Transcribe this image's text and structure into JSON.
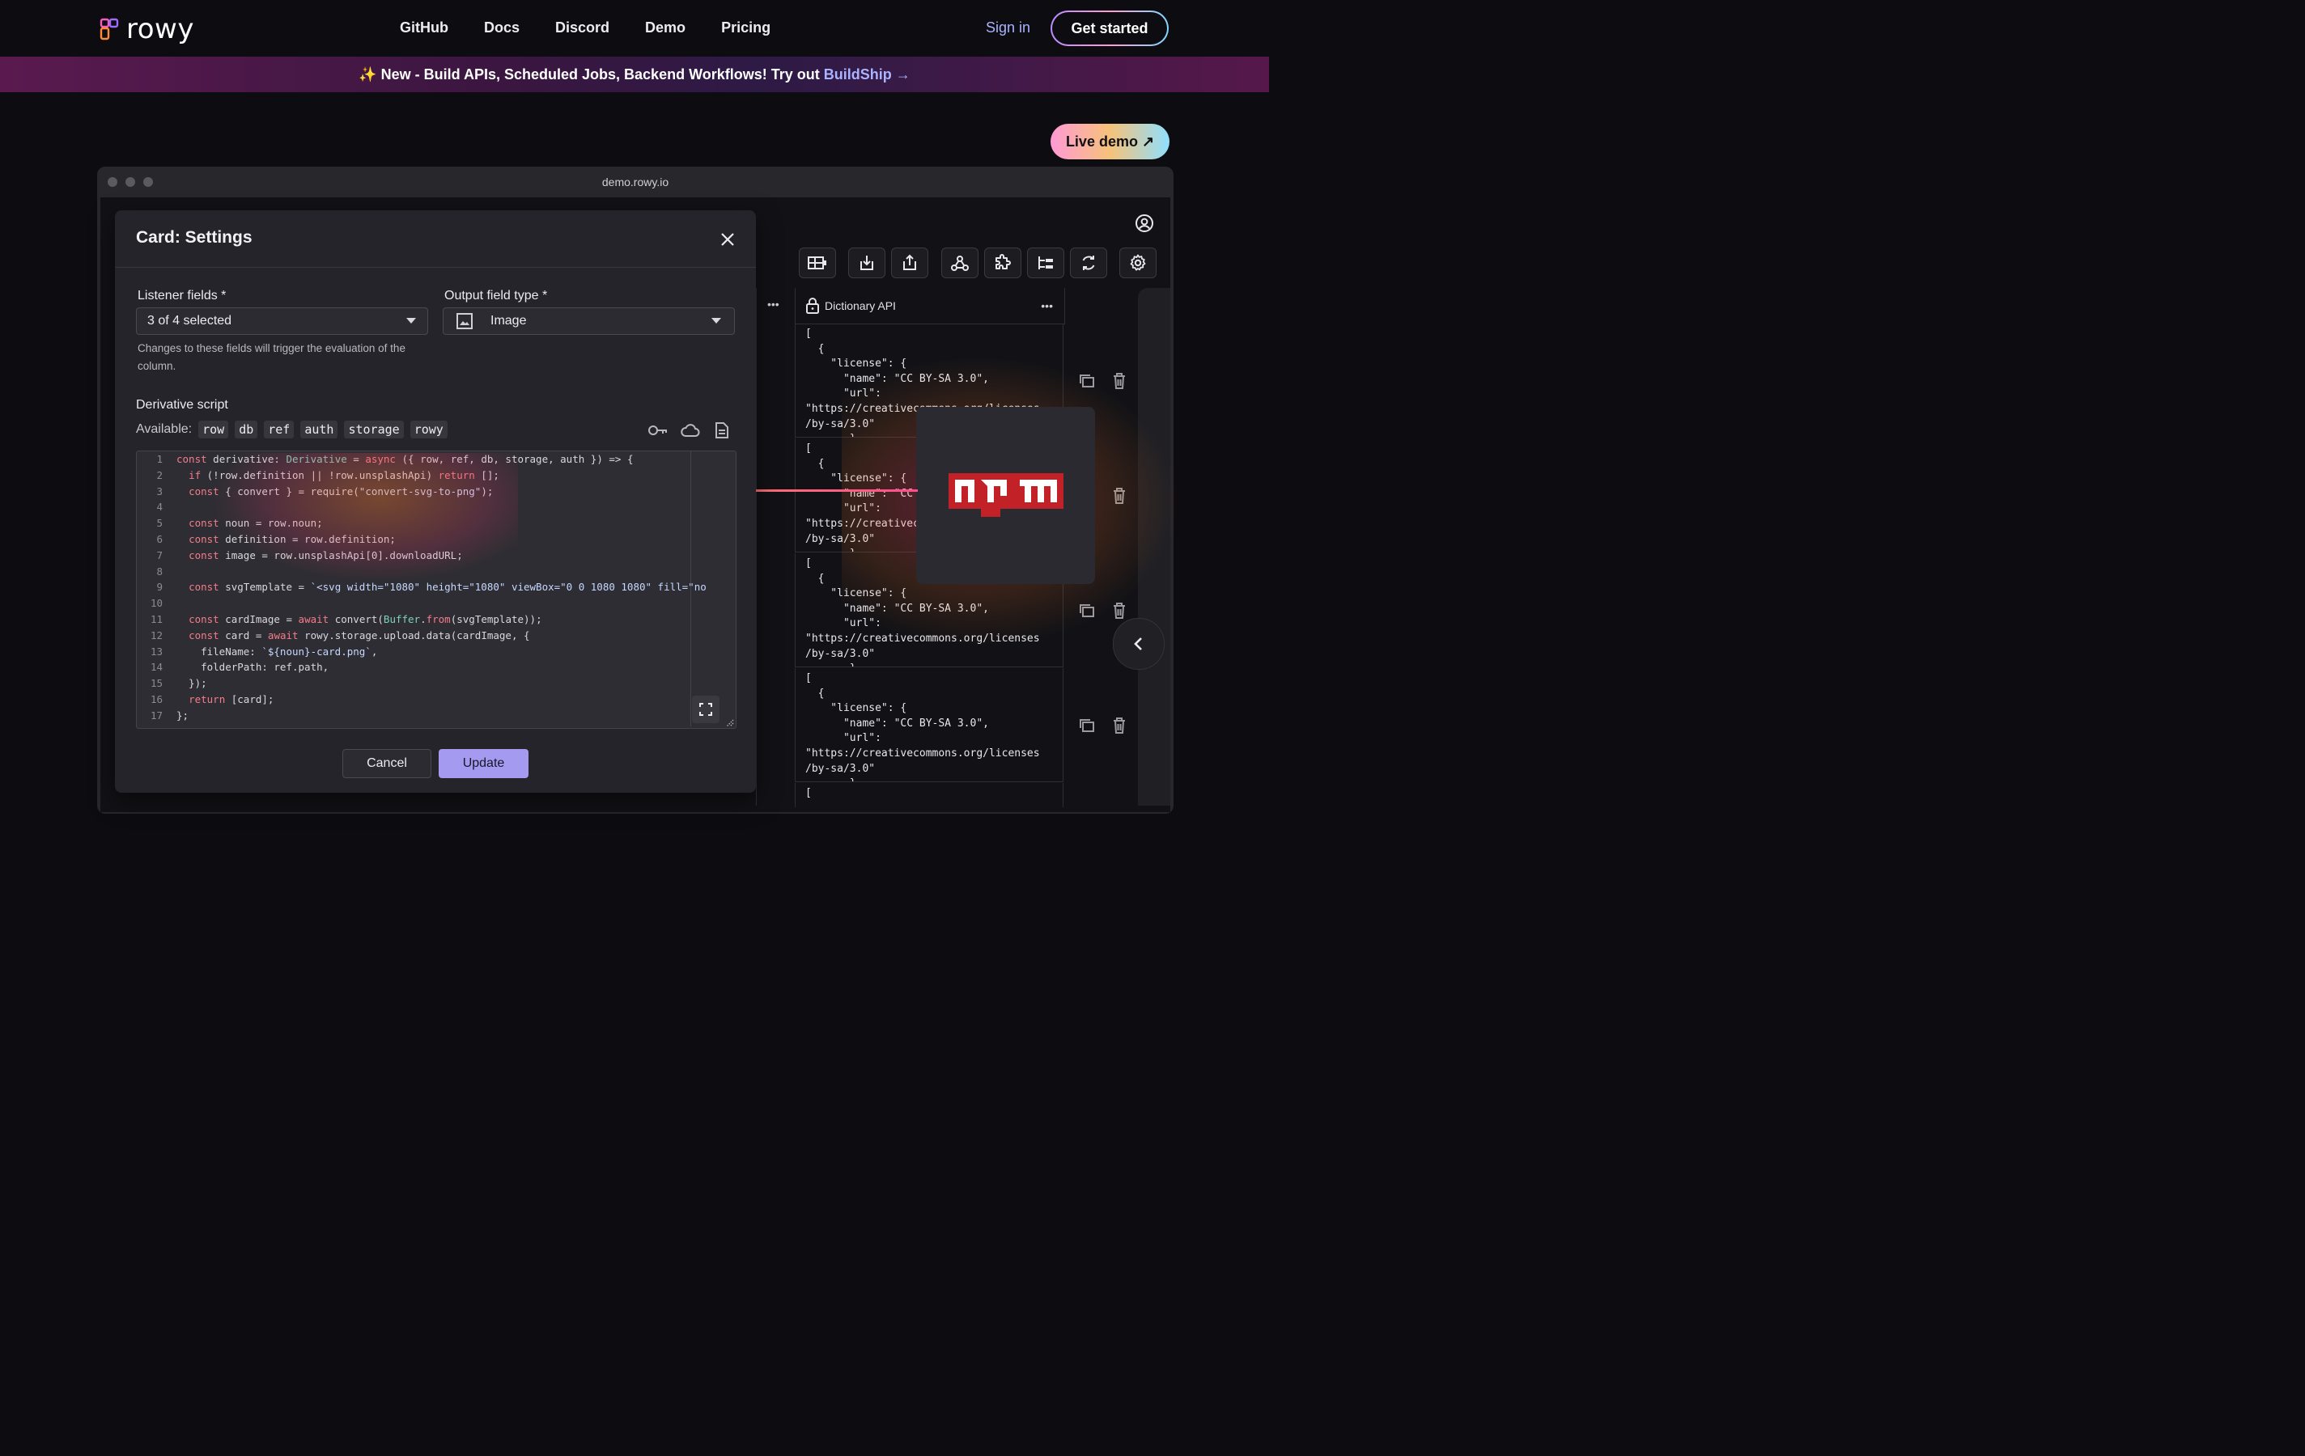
{
  "nav": {
    "logo_text": "rowy",
    "links": [
      "GitHub",
      "Docs",
      "Discord",
      "Demo",
      "Pricing"
    ],
    "sign_in": "Sign in",
    "get_started": "Get started"
  },
  "banner": {
    "text": "✨ New - Build APIs, Scheduled Jobs, Backend Workflows! Try out",
    "link": "BuildShip →"
  },
  "live_demo": "Live demo ↗",
  "browser": {
    "url": "demo.rowy.io"
  },
  "table": {
    "column_title": "Dictionary API",
    "column_menu": "•••",
    "left_menu": "•••",
    "cells": [
      "[\n  {\n    \"license\": {\n      \"name\": \"CC BY-SA 3.0\",\n      \"url\":\n\"https://creativecommons.org/licenses\n/by-sa/3.0\"\n       }",
      "[\n  {\n    \"license\": {\n      \"name\": \"CC BY-SA 3.0\",\n      \"url\":\n\"https://creativecommons.org/licenses\n/by-sa/3.0\"\n       }",
      "[\n  {\n    \"license\": {\n      \"name\": \"CC BY-SA 3.0\",\n      \"url\":\n\"https://creativecommons.org/licenses\n/by-sa/3.0\"\n       }",
      "[\n  {\n    \"license\": {\n      \"name\": \"CC BY-SA 3.0\",\n      \"url\":\n\"https://creativecommons.org/licenses\n/by-sa/3.0\"\n       }",
      "["
    ]
  },
  "dialog": {
    "title": "Card: Settings",
    "listener_label": "Listener fields *",
    "listener_value": "3 of 4 selected",
    "output_label": "Output field type *",
    "output_value": "Image",
    "helper": "Changes to these fields will trigger the evaluation of the column.",
    "script_label": "Derivative script",
    "available_label": "Available:",
    "chips": [
      "row",
      "db",
      "ref",
      "auth",
      "storage",
      "rowy"
    ],
    "cancel": "Cancel",
    "update": "Update"
  },
  "code_lines": [
    {
      "n": "1",
      "t": "const derivative: Derivative = async ({ row, ref, db, storage, auth }) => {"
    },
    {
      "n": "2",
      "t": "  if (!row.definition || !row.unsplashApi) return [];"
    },
    {
      "n": "3",
      "t": "  const { convert } = require(\"convert-svg-to-png\");"
    },
    {
      "n": "4",
      "t": ""
    },
    {
      "n": "5",
      "t": "  const noun = row.noun;"
    },
    {
      "n": "6",
      "t": "  const definition = row.definition;"
    },
    {
      "n": "7",
      "t": "  const image = row.unsplashApi[0].downloadURL;"
    },
    {
      "n": "8",
      "t": ""
    },
    {
      "n": "9",
      "t": "  const svgTemplate = `<svg width=\"1080\" height=\"1080\" viewBox=\"0 0 1080 1080\" fill=\"no"
    },
    {
      "n": "10",
      "t": ""
    },
    {
      "n": "11",
      "t": "  const cardImage = await convert(Buffer.from(svgTemplate));"
    },
    {
      "n": "12",
      "t": "  const card = await rowy.storage.upload.data(cardImage, {"
    },
    {
      "n": "13",
      "t": "    fileName: `${noun}-card.png`,"
    },
    {
      "n": "14",
      "t": "    folderPath: ref.path,"
    },
    {
      "n": "15",
      "t": "  });"
    },
    {
      "n": "16",
      "t": "  return [card];"
    },
    {
      "n": "17",
      "t": "};"
    }
  ],
  "colors": {
    "accent": "#a49bf0",
    "link": "#a9b3ff",
    "npm_red": "#c12127"
  },
  "npm_logo": "npm"
}
